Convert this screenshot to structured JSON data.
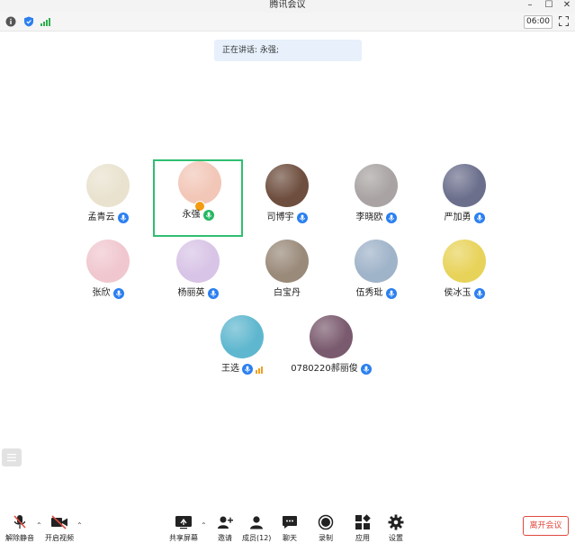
{
  "window": {
    "title": "腾讯会议"
  },
  "infobar": {
    "timer": "06:00"
  },
  "speaking": {
    "text": "正在讲话: 永强;"
  },
  "participants": [
    {
      "name": "孟青云",
      "mic": "mic-on-icon",
      "avatar_color": "#e9e2cf"
    },
    {
      "name": "永强",
      "mic": "mic-on-icon",
      "active": true,
      "avatar_color": "#f2c7b8"
    },
    {
      "name": "司博宇",
      "mic": "mic-on-icon",
      "avatar_color": "#6e4e3e"
    },
    {
      "name": "李晓欧",
      "mic": "mic-on-icon",
      "avatar_color": "#a9a3a3"
    },
    {
      "name": "严加勇",
      "mic": "mic-on-icon",
      "avatar_color": "#6b6f8c"
    },
    {
      "name": "张欣",
      "mic": "mic-on-icon",
      "avatar_color": "#f0c7cf"
    },
    {
      "name": "杨丽英",
      "mic": "mic-on-icon",
      "avatar_color": "#d8c4e6"
    },
    {
      "name": "白宝丹",
      "mic": "",
      "avatar_color": "#9a8a7a"
    },
    {
      "name": "伍秀玭",
      "mic": "mic-on-icon",
      "avatar_color": "#9fb3c9"
    },
    {
      "name": "侯冰玉",
      "mic": "mic-on-icon",
      "avatar_color": "#e8d35a"
    },
    {
      "name": "王选",
      "mic": "mic-on-icon",
      "avatar_color": "#5fb7cf"
    },
    {
      "name": "0780220郝丽俊",
      "mic": "mic-on-icon",
      "avatar_color": "#7a5a6e"
    }
  ],
  "toolbar": {
    "unmute": "解除静音",
    "start_video": "开启视频",
    "share_screen": "共享屏幕",
    "invite": "邀请",
    "members": "成员(12)",
    "chat": "聊天",
    "record": "录制",
    "apps": "应用",
    "settings": "设置",
    "leave": "离开会议"
  },
  "colors": {
    "accent": "#2b7ff0",
    "active_border": "#2fbf71",
    "leave": "#e04a3f"
  }
}
